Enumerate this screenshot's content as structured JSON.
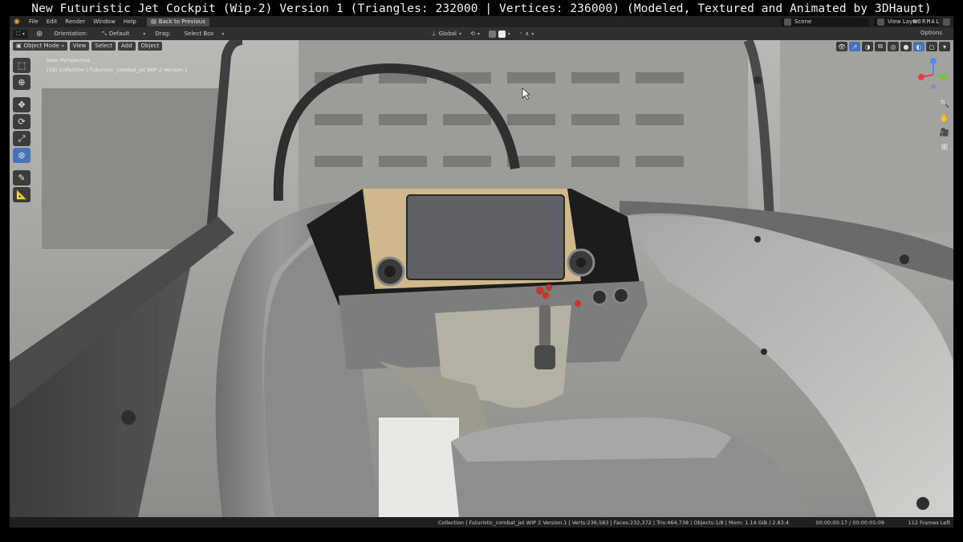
{
  "video_title": "New Futuristic Jet Cockpit (Wip-2) Version 1 (Triangles: 232000 | Vertices: 236000)  (Modeled, Textured and Animated by 3DHaupt)",
  "menubar": {
    "items": [
      "File",
      "Edit",
      "Render",
      "Window",
      "Help"
    ],
    "back_button": "Back to Previous",
    "scene": "Scene",
    "view_layer": "View Layer"
  },
  "header": {
    "orientation_label": "Orientation:",
    "orientation_value": "Default",
    "drag_label": "Drag:",
    "drag_value": "Select Box",
    "transform_orientation": "Global",
    "normal_badge": "NORMAL",
    "options": "Options"
  },
  "viewport": {
    "mode": "Object Mode",
    "menu": [
      "View",
      "Select",
      "Add",
      "Object"
    ],
    "view_name": "User Perspective",
    "collection_info": "(18) Collection | Futuristic_combat_jet WIP 2 Version.1"
  },
  "statusbar": {
    "stats": "Collection | Futuristic_combat_jet WIP 2 Version.1 | Verts:236,583 | Faces:232,372 | Tris:464,738 | Objects:1/8 | Mem: 1.14 GiB | 2.83.4",
    "time": "00:00:00:17 / 00:00:05:09",
    "frames_left": "112 Frames Left"
  },
  "colors": {
    "accent": "#4a72b5",
    "panel_tan": "#cdb98b",
    "screen": "#5f5f66"
  }
}
